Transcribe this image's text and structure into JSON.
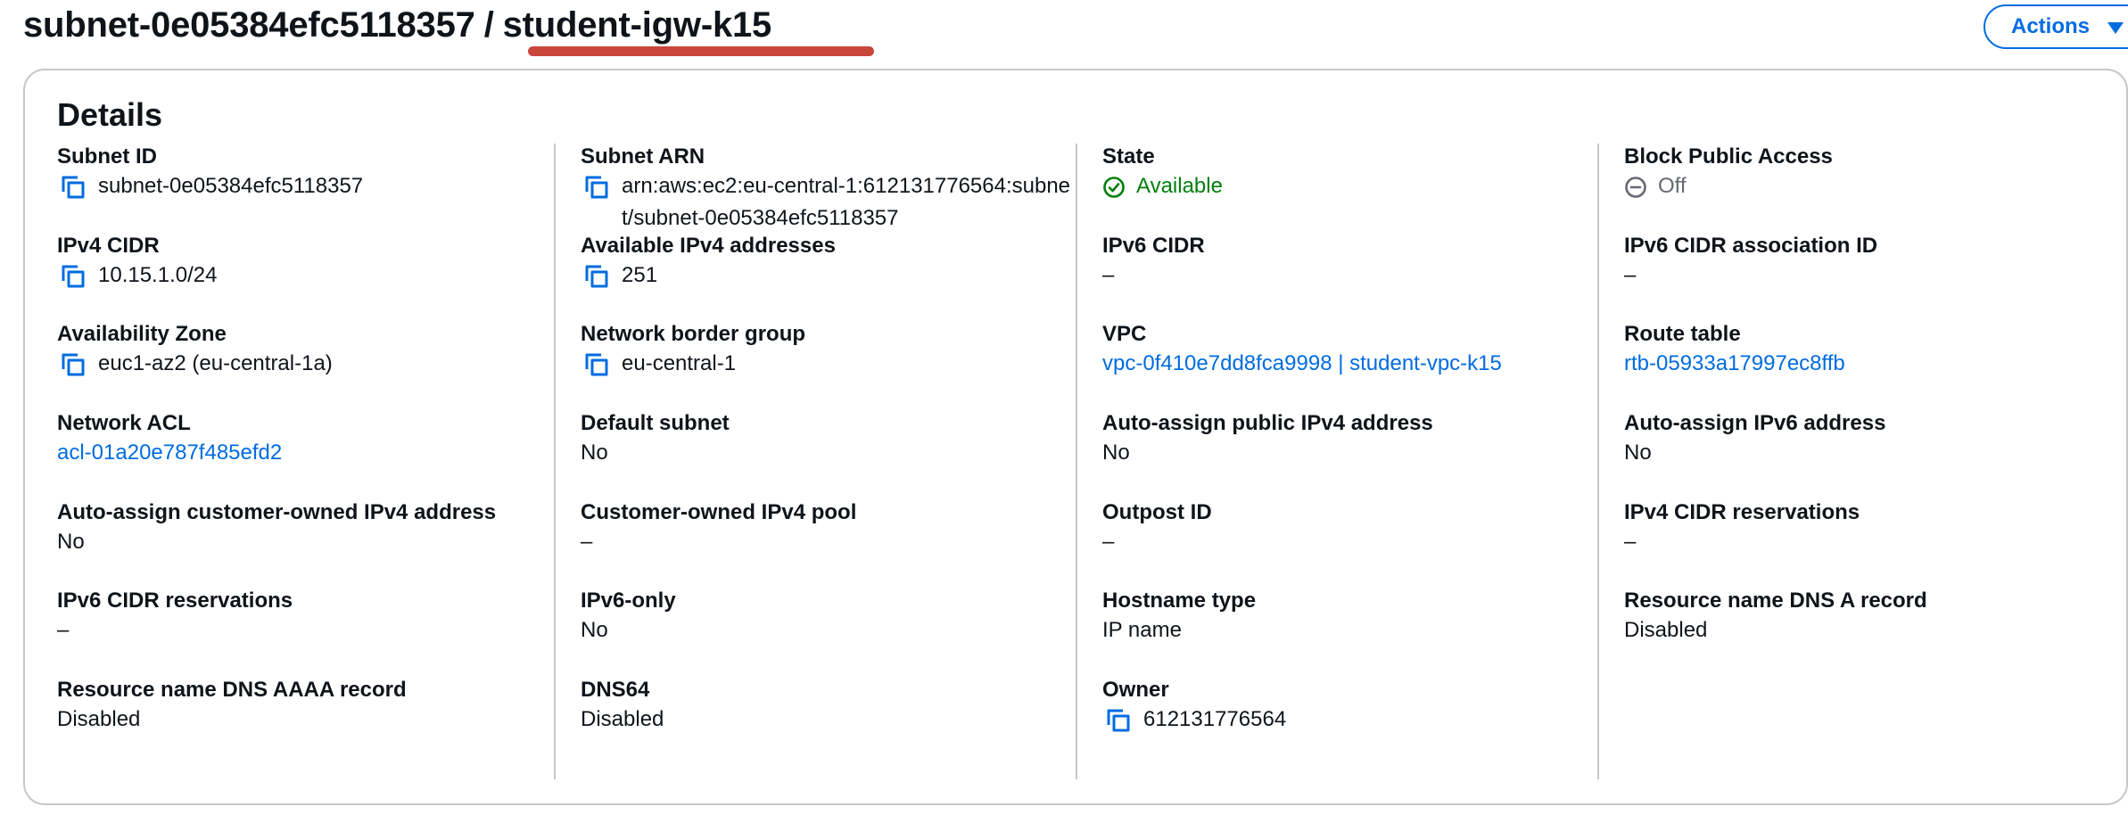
{
  "header": {
    "subnet_id": "subnet-0e05384efc5118357",
    "separator": "/",
    "name": "student-igw-k15",
    "actions_label": "Actions"
  },
  "details": {
    "heading": "Details",
    "columns": [
      [
        {
          "label": "Subnet ID",
          "value": "subnet-0e05384efc5118357",
          "copy": true
        },
        {
          "label": "IPv4 CIDR",
          "value": "10.15.1.0/24",
          "copy": true
        },
        {
          "label": "Availability Zone",
          "value": "euc1-az2 (eu-central-1a)",
          "copy": true
        },
        {
          "label": "Network ACL",
          "value": "acl-01a20e787f485efd2",
          "link": true
        },
        {
          "label": "Auto-assign customer-owned IPv4 address",
          "value": "No"
        },
        {
          "label": "IPv6 CIDR reservations",
          "value": "–"
        },
        {
          "label": "Resource name DNS AAAA record",
          "value": "Disabled"
        }
      ],
      [
        {
          "label": "Subnet ARN",
          "value": "arn:aws:ec2:eu-central-1:612131776564:subnet/subnet-0e05384efc5118357",
          "copy": true
        },
        {
          "label": "Available IPv4 addresses",
          "value": "251",
          "copy": true
        },
        {
          "label": "Network border group",
          "value": "eu-central-1",
          "copy": true
        },
        {
          "label": "Default subnet",
          "value": "No"
        },
        {
          "label": "Customer-owned IPv4 pool",
          "value": "–"
        },
        {
          "label": "IPv6-only",
          "value": "No"
        },
        {
          "label": "DNS64",
          "value": "Disabled"
        }
      ],
      [
        {
          "label": "State",
          "value": "Available",
          "status": "available"
        },
        {
          "label": "IPv6 CIDR",
          "value": "–"
        },
        {
          "label": "VPC",
          "value": "vpc-0f410e7dd8fca9998 | student-vpc-k15",
          "link": true
        },
        {
          "label": "Auto-assign public IPv4 address",
          "value": "No"
        },
        {
          "label": "Outpost ID",
          "value": "–"
        },
        {
          "label": "Hostname type",
          "value": "IP name"
        },
        {
          "label": "Owner",
          "value": "612131776564",
          "copy": true
        }
      ],
      [
        {
          "label": "Block Public Access",
          "value": "Off",
          "status": "off"
        },
        {
          "label": "IPv6 CIDR association ID",
          "value": "–"
        },
        {
          "label": "Route table",
          "value": "rtb-05933a17997ec8ffb",
          "link": true
        },
        {
          "label": "Auto-assign IPv6 address",
          "value": "No"
        },
        {
          "label": "IPv4 CIDR reservations",
          "value": "–"
        },
        {
          "label": "Resource name DNS A record",
          "value": "Disabled"
        }
      ]
    ]
  },
  "colors": {
    "link": "#006ce0",
    "success": "#037f0c",
    "annotation_underline": "#c8463c",
    "border": "#c6c6cd"
  },
  "icons": {
    "copy": "copy-icon",
    "available": "status-available-icon",
    "off": "status-off-icon",
    "actions_caret": "caret-down-icon"
  }
}
